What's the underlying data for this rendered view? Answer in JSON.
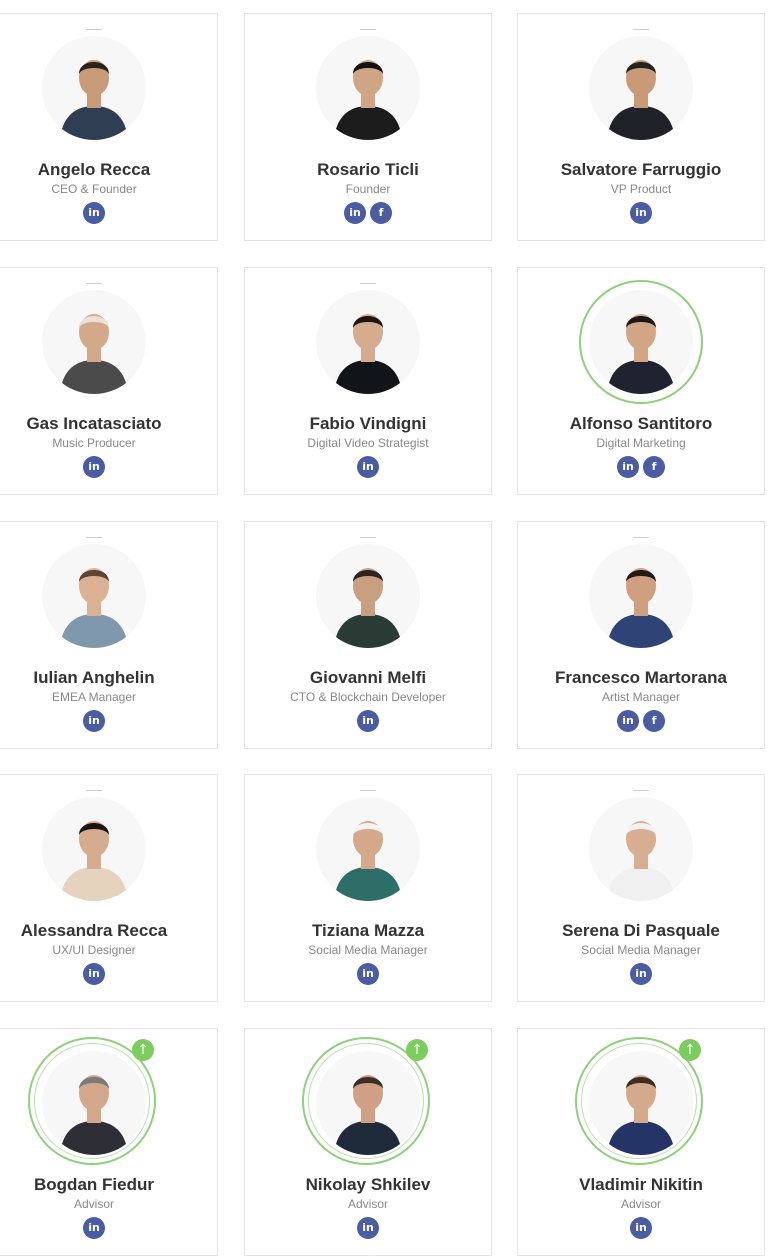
{
  "colors": {
    "social": "#4a5ca4",
    "accent_green": "#7ccc5e",
    "card_border": "#e3e3e3"
  },
  "members": [
    {
      "name": "Angelo Recca",
      "role": "CEO & Founder",
      "socials": [
        "linkedin"
      ],
      "shirt": "#2f3e52",
      "skin": "#c99b78",
      "hair": "#2a221d"
    },
    {
      "name": "Rosario Ticli",
      "role": "Founder",
      "socials": [
        "linkedin",
        "facebook"
      ],
      "shirt": "#1c1c1c",
      "skin": "#d0a585",
      "hair": "#111111"
    },
    {
      "name": "Salvatore Farruggio",
      "role": "VP Product",
      "socials": [
        "linkedin"
      ],
      "shirt": "#1f2228",
      "skin": "#c89a78",
      "hair": "#222222"
    },
    {
      "name": "Gas Incatasciato",
      "role": "Music Producer",
      "socials": [
        "linkedin"
      ],
      "shirt": "#4b4b4b",
      "skin": "#d3a98a",
      "hair": "#e8e1d6"
    },
    {
      "name": "Fabio Vindigni",
      "role": "Digital Video Strategist",
      "socials": [
        "linkedin"
      ],
      "shirt": "#111418",
      "skin": "#d5ad8e",
      "hair": "#1d1612"
    },
    {
      "name": "Alfonso Santitoro",
      "role": "Digital Marketing",
      "socials": [
        "linkedin",
        "facebook"
      ],
      "shirt": "#1f2330",
      "skin": "#d2a685",
      "hair": "#1b1a19",
      "ring": "single"
    },
    {
      "name": "Iulian Anghelin",
      "role": "EMEA Manager",
      "socials": [
        "linkedin"
      ],
      "shirt": "#7f98ad",
      "skin": "#dbb194",
      "hair": "#5a4635"
    },
    {
      "name": "Giovanni Melfi",
      "role": "CTO & Blockchain Developer",
      "socials": [
        "linkedin"
      ],
      "shirt": "#2a3a35",
      "skin": "#c99f82",
      "hair": "#2a2520"
    },
    {
      "name": "Francesco Martorana",
      "role": "Artist Manager",
      "socials": [
        "linkedin",
        "facebook"
      ],
      "shirt": "#2f4377",
      "skin": "#cf9f7f",
      "hair": "#221b17"
    },
    {
      "name": "Alessandra Recca",
      "role": "UX/UI Designer",
      "socials": [
        "linkedin"
      ],
      "shirt": "#e6d3bd",
      "skin": "#d6ac8e",
      "hair": "#1a1412"
    },
    {
      "name": "Tiziana Mazza",
      "role": "Social Media Manager",
      "socials": [
        "linkedin"
      ],
      "shirt": "#2d6f66",
      "skin": "#d4a98b",
      "hair": "#f2f2f2"
    },
    {
      "name": "Serena Di Pasquale",
      "role": "Social Media Manager",
      "socials": [
        "linkedin"
      ],
      "shirt": "#f0f0f0",
      "skin": "#d7ae92",
      "hair": "#f2f2f2"
    },
    {
      "name": "Bogdan Fiedur",
      "role": "Advisor",
      "socials": [
        "linkedin"
      ],
      "shirt": "#2e2f36",
      "skin": "#d3a88a",
      "hair": "#7a7a7a",
      "ring": "advisor"
    },
    {
      "name": "Nikolay Shkilev",
      "role": "Advisor",
      "socials": [
        "linkedin"
      ],
      "shirt": "#1f2a3a",
      "skin": "#cfa083",
      "hair": "#3a2f25",
      "ring": "advisor"
    },
    {
      "name": "Vladimir Nikitin",
      "role": "Advisor",
      "socials": [
        "linkedin"
      ],
      "shirt": "#243466",
      "skin": "#d4aa8c",
      "hair": "#3c2f22",
      "ring": "advisor"
    }
  ],
  "social_glyphs": {
    "linkedin": "in",
    "facebook": "f"
  },
  "advisor_badge_glyph": "↑"
}
